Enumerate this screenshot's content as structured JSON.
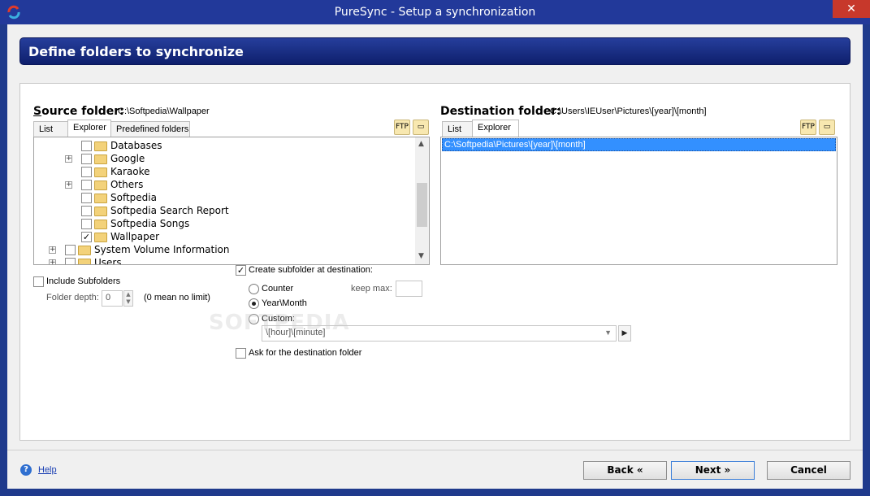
{
  "window": {
    "title": "PureSync - Setup a synchronization",
    "close_label": "✕"
  },
  "header": {
    "title": "Define folders to synchronize"
  },
  "source": {
    "label": "Source folder:",
    "path": "C:\\Softpedia\\Wallpaper",
    "tabs": [
      "List",
      "Explorer",
      "Predefined folders"
    ],
    "active_tab": "Explorer",
    "tree": [
      {
        "label": "Databases",
        "checked": false,
        "expander": false,
        "level": 2
      },
      {
        "label": "Google",
        "checked": false,
        "expander": true,
        "level": 2
      },
      {
        "label": "Karaoke",
        "checked": false,
        "expander": false,
        "level": 2
      },
      {
        "label": "Others",
        "checked": false,
        "expander": true,
        "level": 2
      },
      {
        "label": "Softpedia",
        "checked": false,
        "expander": false,
        "level": 2
      },
      {
        "label": "Softpedia Search Report",
        "checked": false,
        "expander": false,
        "level": 2
      },
      {
        "label": "Softpedia Songs",
        "checked": false,
        "expander": false,
        "level": 2
      },
      {
        "label": "Wallpaper",
        "checked": true,
        "expander": false,
        "level": 2
      },
      {
        "label": "System Volume Information",
        "checked": false,
        "expander": true,
        "level": 1
      },
      {
        "label": "Users",
        "checked": false,
        "expander": true,
        "level": 1
      }
    ],
    "include_subfolders": "Include Subfolders",
    "folder_depth_label": "Folder depth:",
    "folder_depth_value": "0",
    "folder_depth_hint": "(0 mean no limit)"
  },
  "destination": {
    "label": "Destination folder:",
    "path": "C:\\Users\\IEUser\\Pictures\\[year]\\[month]",
    "tabs": [
      "List",
      "Explorer"
    ],
    "active_tab": "Explorer",
    "selected_item": "C:\\Softpedia\\Pictures\\[year]\\[month]"
  },
  "subfolder": {
    "create_label": "Create subfolder at destination:",
    "create_checked": true,
    "counter_label": "Counter",
    "keep_max_label": "keep max:",
    "yearmonth_label": "Year\\Month",
    "custom_label": "Custom:",
    "custom_value": "\\[hour]\\[minute]",
    "selected": "Year\\Month",
    "ask_label": "Ask for the destination folder"
  },
  "footer": {
    "help": "Help",
    "back": "Back «",
    "next": "Next »",
    "cancel": "Cancel"
  },
  "watermark": "SOFTPEDIA"
}
